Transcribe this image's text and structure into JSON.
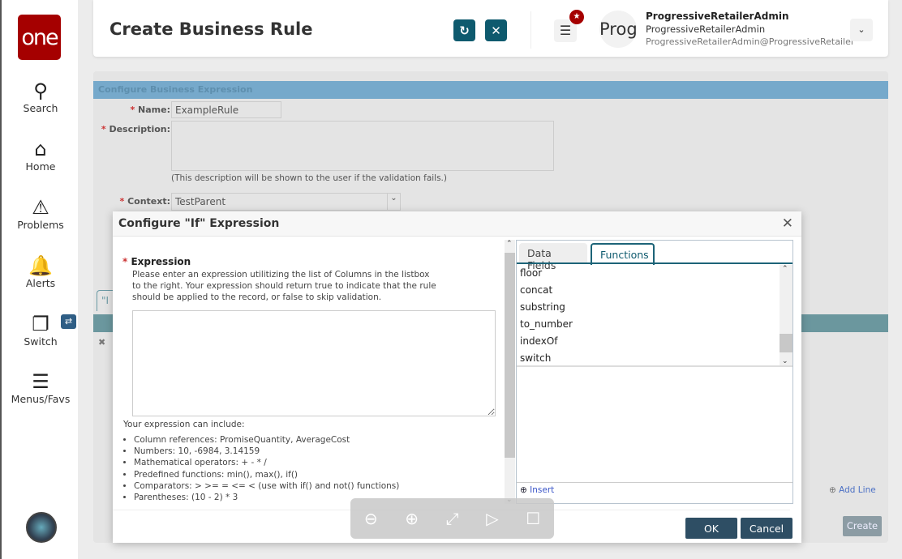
{
  "logo": "one",
  "sidebar": {
    "items": [
      {
        "label": "Search",
        "icon": "search-icon"
      },
      {
        "label": "Home",
        "icon": "home-icon"
      },
      {
        "label": "Problems",
        "icon": "warning-icon"
      },
      {
        "label": "Alerts",
        "icon": "bell-icon"
      },
      {
        "label": "Switch",
        "icon": "switch-icon"
      },
      {
        "label": "Menus/Favs",
        "icon": "menu-icon"
      }
    ]
  },
  "header": {
    "title": "Create Business Rule",
    "avatar_text": "Prog",
    "user": {
      "name": "ProgressiveRetailerAdmin",
      "role": "ProgressiveRetailerAdmin",
      "email": "ProgressiveRetailerAdmin@ProgressiveRetailer"
    }
  },
  "main": {
    "section_title": "Configure Business Expression",
    "name_label": "Name:",
    "name_value": "ExampleRule",
    "description_label": "Description:",
    "description_hint": "(This description will be shown to the user if the validation fails.)",
    "context_label": "Context:",
    "context_value": "TestParent",
    "add_line": "Add Line",
    "create": "Create",
    "tab_partial": "\"I"
  },
  "dialog": {
    "title": "Configure \"If\" Expression",
    "expression_label": "Expression",
    "instructions": "Please enter an expression utilitizing the list of Columns in the listbox to the right. Your expression should return true to indicate that the rule should be applied to the record, or false to skip validation.",
    "expression_value": "",
    "include_title": "Your expression can include:",
    "include_items": [
      "Column references: PromiseQuantity, AverageCost",
      "Numbers: 10, -6984, 3.14159",
      "Mathematical operators: + - * /",
      "Predefined functions: min(), max(), if()",
      "Comparators: > >= = <= < (use with if() and not() functions)",
      "Parentheses: (10 - 2) * 3"
    ],
    "tabs": [
      {
        "label": "Data Fields",
        "active": false
      },
      {
        "label": "Functions",
        "active": true
      }
    ],
    "functions": [
      "floor",
      "concat",
      "substring",
      "to_number",
      "indexOf",
      "switch"
    ],
    "insert": "Insert",
    "ok": "OK",
    "cancel": "Cancel"
  },
  "colors": {
    "brand": "#a50000",
    "teal": "#0e5a6e",
    "section_bar": "#76a9cb",
    "button": "#2e4e64"
  }
}
